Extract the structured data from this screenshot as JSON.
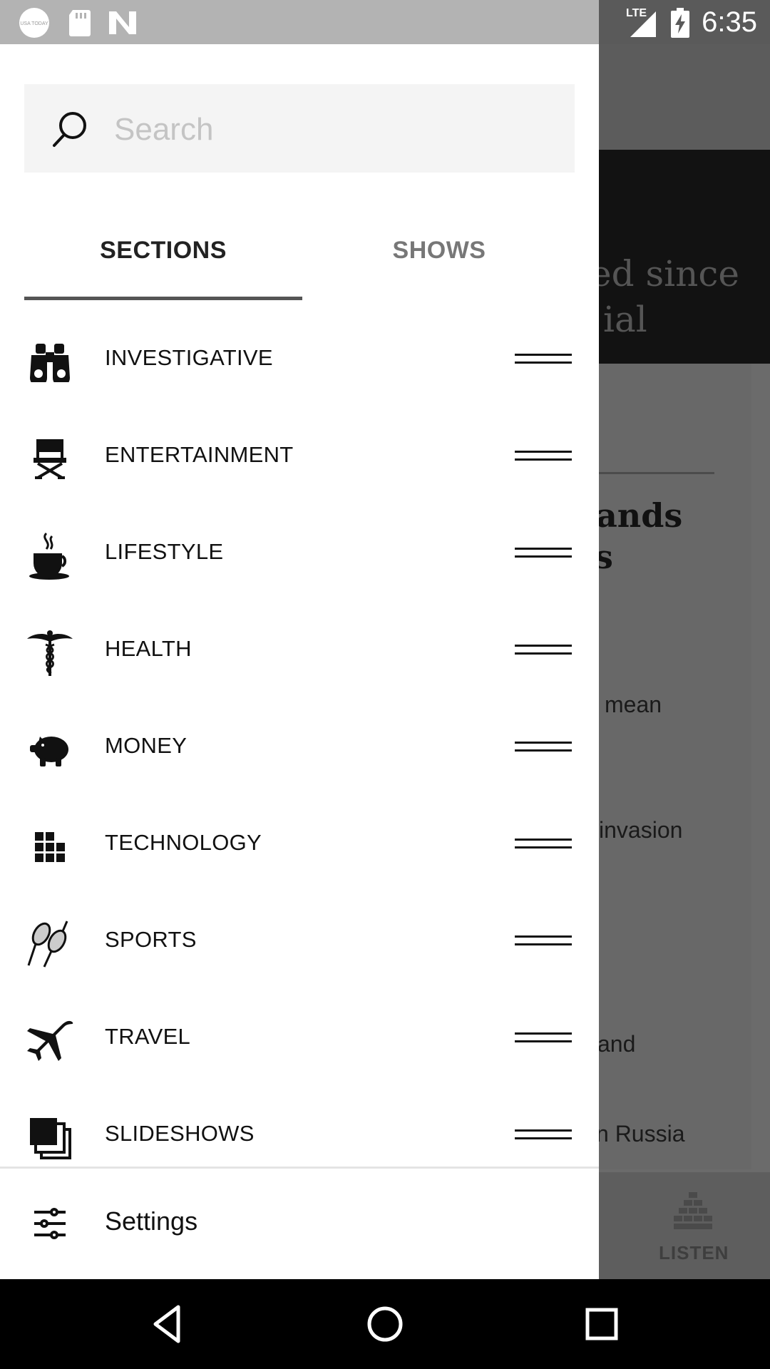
{
  "status_bar": {
    "time": "6:35",
    "network": "LTE",
    "notification_icons": [
      "usa-today-icon",
      "sd-card-icon",
      "n-app-icon"
    ],
    "usa_today_badge": "USA TODAY"
  },
  "background_app": {
    "hero_text": [
      "ed since",
      "ial"
    ],
    "headline": [
      "ands",
      "s"
    ],
    "lines": [
      "mean",
      "invasion",
      "and",
      "n Russia"
    ],
    "listen_label": "LISTEN"
  },
  "drawer": {
    "search": {
      "placeholder": "Search",
      "value": ""
    },
    "tabs": [
      {
        "label": "SECTIONS",
        "selected": true
      },
      {
        "label": "SHOWS",
        "selected": false
      }
    ],
    "sections": [
      {
        "label": "INVESTIGATIVE",
        "icon": "binoculars-icon"
      },
      {
        "label": "ENTERTAINMENT",
        "icon": "director-chair-icon"
      },
      {
        "label": "LIFESTYLE",
        "icon": "coffee-cup-icon"
      },
      {
        "label": "HEALTH",
        "icon": "caduceus-icon"
      },
      {
        "label": "MONEY",
        "icon": "piggy-bank-icon"
      },
      {
        "label": "TECHNOLOGY",
        "icon": "grid-blocks-icon"
      },
      {
        "label": "SPORTS",
        "icon": "tennis-rackets-icon"
      },
      {
        "label": "TRAVEL",
        "icon": "airplane-icon"
      },
      {
        "label": "SLIDESHOWS",
        "icon": "stacked-photos-icon"
      }
    ],
    "settings_label": "Settings"
  },
  "colors": {
    "drawer_bg": "#ffffff",
    "search_bg": "#f4f4f4",
    "tab_indicator": "#555555",
    "scrim": "#6b6b6b"
  }
}
